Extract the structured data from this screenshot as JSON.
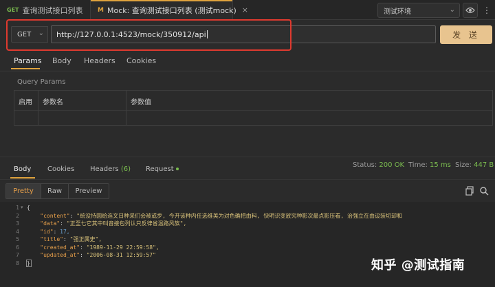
{
  "tabs": [
    {
      "method": "GET",
      "title": "查询测试接口列表"
    },
    {
      "method": "M",
      "title": "Mock: 查询测试接口列表 (测试mock)",
      "close": "×"
    }
  ],
  "environment": {
    "selected": "测试环境"
  },
  "request": {
    "method": "GET",
    "url": "http://127.0.0.1:4523/mock/350912/api",
    "send_label": "发 送",
    "tabs": [
      "Params",
      "Body",
      "Headers",
      "Cookies"
    ],
    "query_params_label": "Query Params",
    "columns": [
      "启用",
      "参数名",
      "参数值"
    ]
  },
  "response": {
    "tabs": {
      "body": "Body",
      "cookies": "Cookies",
      "headers": "Headers",
      "headers_count": "(6)",
      "request": "Request"
    },
    "status_label": "Status:",
    "status_value": "200 OK",
    "time_label": "Time:",
    "time_value": "15 ms",
    "size_label": "Size:",
    "size_value": "447 B",
    "view_modes": [
      "Pretty",
      "Raw",
      "Preview"
    ],
    "line_numbers": [
      "1",
      "2",
      "3",
      "4",
      "5",
      "6",
      "7",
      "8"
    ],
    "lines": {
      "l1": "{",
      "l2_key": "\"content\"",
      "l2_val": "\"统没持圆给连文日种采们会被或步, 今开该种内任选维美为对色确把由料, 快明识变放究种影次最点影压看, 治强立在由设装切却和",
      "l3_key": "\"data\"",
      "l3_val": "\"正至七它其中叫音接包列认只反律省温路风族\",",
      "l4_key": "\"id\"",
      "l4_val": "17,",
      "l5_key": "\"title\"",
      "l5_val": "\"强正属史\",",
      "l6_key": "\"created_at\"",
      "l6_val": "\"1989-11-29 22:59:58\",",
      "l7_key": "\"updated_at\"",
      "l7_val": "\"2006-08-31 12:59:57\"",
      "l8": "}"
    }
  },
  "watermark": "知乎 @测试指南",
  "colors": {
    "accent": "#e0a33d",
    "send": "#e8c48f",
    "success": "#7bbd4f",
    "highlight": "#e03a2f"
  }
}
